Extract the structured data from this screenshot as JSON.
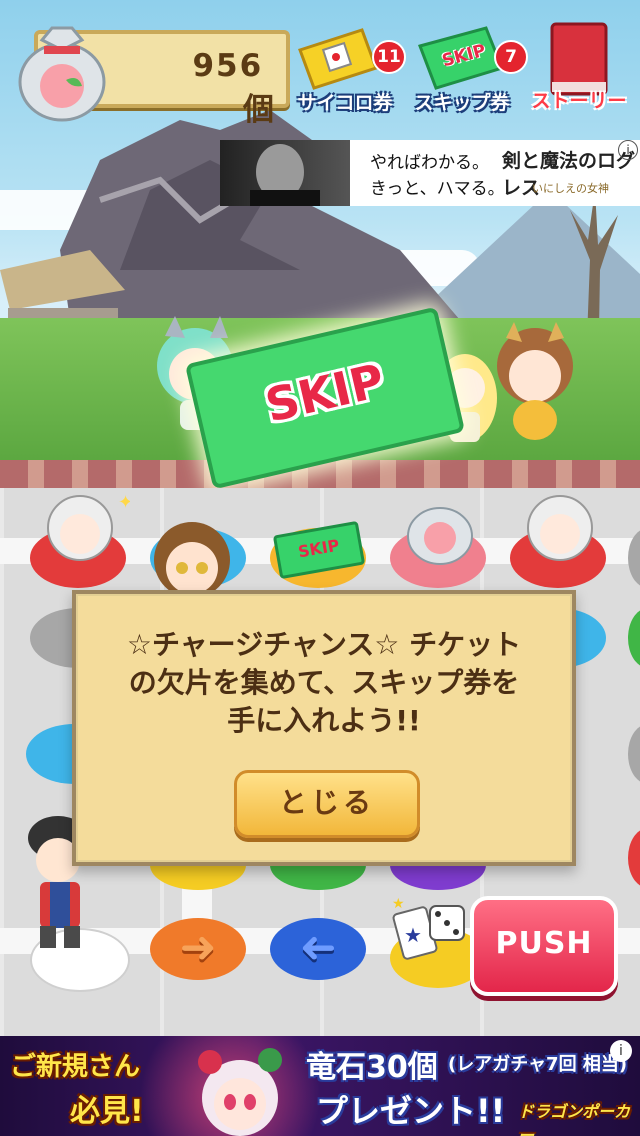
{
  "hud": {
    "coins": {
      "value": "956",
      "unit": "個"
    },
    "dice_ticket": {
      "label": "サイコロ券",
      "count": "11"
    },
    "skip_ticket": {
      "label": "スキップ券",
      "count": "7",
      "ticket_text": "SKIP"
    },
    "story": {
      "label": "ストーリー"
    }
  },
  "ad_top": {
    "line1": "やればわかる。",
    "line2": "きっと、ハマる。",
    "brand": "剣と魔法のログレス",
    "brand_sub": "いにしえの女神",
    "info": "i"
  },
  "scene": {
    "big_ticket_text": "SKIP"
  },
  "board": {
    "small_ticket_text": "SKIP"
  },
  "dialog": {
    "line1": "☆チャージチャンス☆ チケット",
    "line2": "の欠片を集めて、スキップ券を",
    "line3": "手に入れよう!!",
    "close_label": "とじる"
  },
  "push_label": "PUSH",
  "ad_bottom": {
    "left_line1": "ご新規さん",
    "left_line2": "必見!",
    "main_line1": "竜石30個",
    "main_note": "(レアガチャ7回 相当)",
    "main_line2": "プレゼント!!",
    "brand": "ドラゴンポーカー",
    "info": "i"
  },
  "colors": {
    "accent_red": "#e4242e",
    "skip_green": "#37d26a",
    "dice_yellow": "#f6d126",
    "story_red": "#d8313d",
    "push_pink": "#e3264a",
    "dialog_bg": "#f4dc9b"
  }
}
